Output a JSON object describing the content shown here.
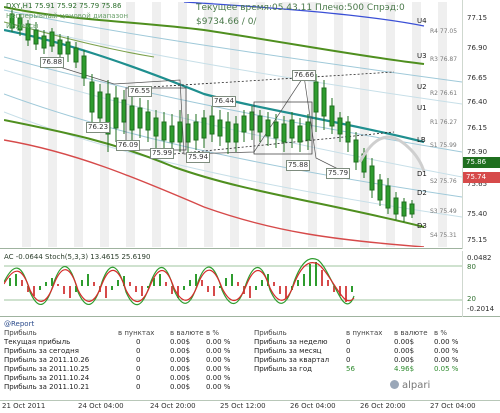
{
  "header": {
    "symbol_line": "DXY,H1  75.91 75.92 75.79 75.86",
    "line2": "Непрерывный ценовой диапазон",
    "line3": "Индексы",
    "server_time": "Текущее время:05.43.11 Плечо:500 Спрэд:0",
    "equity": "$9734.66    / 0/"
  },
  "price_axis": {
    "ticks": [
      "77.15",
      "76.90",
      "76.65",
      "76.40",
      "76.15",
      "75.90",
      "75.65",
      "75.40",
      "75.15"
    ],
    "levels_right": [
      "R4 77.05",
      "R3 76.87",
      "R2 76.61",
      "R1 76.27",
      "S1 75.99",
      "S2 75.76",
      "S3 75.49",
      "S4 75.31"
    ],
    "current_price": "75.86",
    "marker2": "75.74"
  },
  "pivot_labels": [
    "U4",
    "U3",
    "U2",
    "U1",
    "LB",
    "D1",
    "D2",
    "D3"
  ],
  "price_boxes": [
    "76.88",
    "76.55",
    "76.23",
    "76.09",
    "75.99",
    "75.94",
    "76.44",
    "75.88",
    "76.66",
    "75.79"
  ],
  "oscillator": {
    "title": "AC -0.0644  Stoch(5,3,3) 13.4615 25.6190",
    "ticks": [
      "0.0482",
      "80",
      "20",
      "-0.2014"
    ]
  },
  "report": {
    "title": "@Report",
    "headers_left": [
      "Прибыль",
      "в пунктах",
      "в валюте",
      "в %"
    ],
    "headers_right": [
      "Прибыль",
      "в пунктах",
      "в валюте",
      "в %"
    ],
    "rows_left": [
      [
        "Текущая прибыль",
        "0",
        "0.00$",
        "0.00 %"
      ],
      [
        "Прибыль за сегодня",
        "0",
        "0.00$",
        "0.00 %"
      ],
      [
        "Прибыль за 2011.10.26",
        "0",
        "0.00$",
        "0.00 %"
      ],
      [
        "Прибыль за 2011.10.25",
        "0",
        "0.00$",
        "0.00 %"
      ],
      [
        "Прибыль за 2011.10.24",
        "0",
        "0.00$",
        "0.00 %"
      ],
      [
        "Прибыль за 2011.10.21",
        "0",
        "0.00$",
        "0.00 %"
      ]
    ],
    "rows_right": [
      [
        "Прибыль за неделю",
        "0",
        "0.00$",
        "0.00 %"
      ],
      [
        "Прибыль за месяц",
        "0",
        "0.00$",
        "0.00 %"
      ],
      [
        "Прибыль за квартал",
        "0",
        "0.00$",
        "0.00 %"
      ],
      [
        "Прибыль за год",
        "56",
        "4.96$",
        "0.05 %"
      ]
    ]
  },
  "time_axis": [
    "21 Oct 2011",
    "24 Oct 04:00",
    "24 Oct 20:00",
    "25 Oct 12:00",
    "26 Oct 04:00",
    "26 Oct 20:00",
    "27 Oct 04:00"
  ],
  "brand": "alpari",
  "colors": {
    "bull_candle": "#1f8f1f",
    "bear_candle": "#1f8f1f",
    "teal_ma": "#1f8f8f",
    "olive_band": "#4f8f1f",
    "red_band": "#d64a4a",
    "blue_band": "#3a4fd6",
    "stripe": "#ececec",
    "forecast": "#bdbdbd"
  }
}
